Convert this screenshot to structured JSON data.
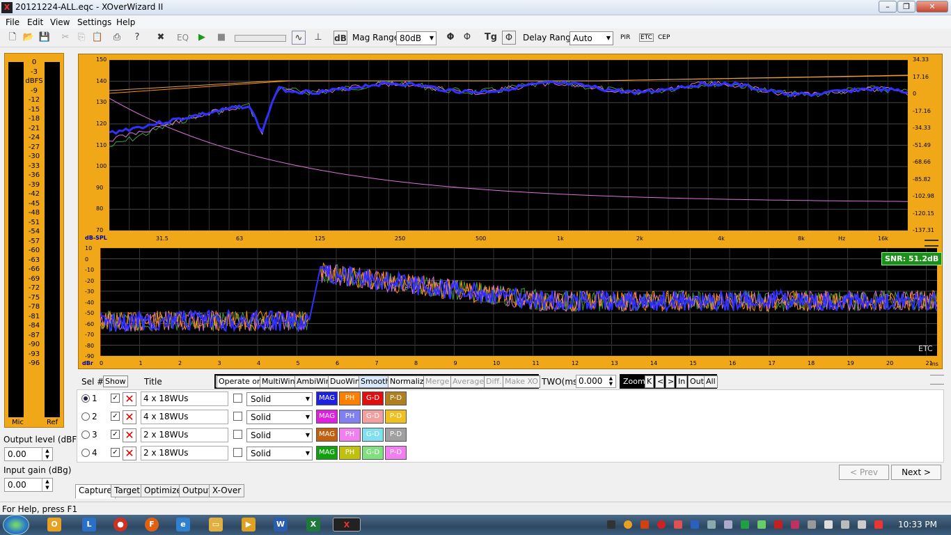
{
  "window": {
    "title": "20121224-ALL.eqc - XOverWizard II",
    "app_icon": "X"
  },
  "menu": [
    "File",
    "Edit",
    "View",
    "Settings",
    "Help"
  ],
  "toolbar": {
    "eq": "EQ",
    "db": "dB",
    "mag_range_label": "Mag Range",
    "mag_range_value": "80dB",
    "tg": "Tg",
    "delay_range_label": "Delay Range",
    "delay_range_value": "Auto",
    "pir": "PIR",
    "etc": "ETC",
    "cep": "CEP"
  },
  "meter": {
    "scale": [
      "0",
      "-3",
      "dBFS",
      "-9",
      "-12",
      "-15",
      "-18",
      "-21",
      "-24",
      "-27",
      "-30",
      "-33",
      "-36",
      "-39",
      "-42",
      "-45",
      "-48",
      "-51",
      "-54",
      "-57",
      "-60",
      "-63",
      "-66",
      "-69",
      "-72",
      "-75",
      "-78",
      "-81",
      "-84",
      "-87",
      "-90",
      "-93",
      "-96"
    ],
    "left_label": "Mic",
    "right_label": "Ref"
  },
  "output_level": {
    "label": "Output level (dBFS)",
    "value": "0.00"
  },
  "input_gain": {
    "label": "Input gain (dBg)",
    "value": "0.00"
  },
  "top_plot": {
    "unit_label": "dB-SPL",
    "left_ticks": [
      "150",
      "140",
      "130",
      "120",
      "110",
      "100",
      "90",
      "80",
      "70"
    ],
    "right_ticks": [
      "34.33",
      "17.16",
      "0",
      "-17.16",
      "-34.33",
      "-51.49",
      "-68.66",
      "-85.82",
      "-102.98",
      "-120.15",
      "-137.31"
    ],
    "x_ticks": [
      "31.5",
      "63",
      "125",
      "250",
      "500",
      "1k",
      "2k",
      "4k",
      "8k",
      "Hz",
      "16k"
    ],
    "colors": {
      "bg": "#000000",
      "frame": "#f0a818",
      "main": "#3030ff",
      "pink": "#e070e0",
      "green": "#40a040",
      "orange": "#ff9000",
      "tan": "#e0a050"
    }
  },
  "bottom_plot": {
    "unit_label": "dBr",
    "y_ticks": [
      "10",
      "0",
      "-10",
      "-20",
      "-30",
      "-40",
      "-50",
      "-60",
      "-70",
      "-80",
      "-90"
    ],
    "x_ticks": [
      "0",
      "1",
      "2",
      "3",
      "4",
      "5",
      "6",
      "7",
      "8",
      "9",
      "10",
      "11",
      "12",
      "13",
      "14",
      "15",
      "16",
      "17",
      "18",
      "19",
      "20",
      "21"
    ],
    "x_unit": "ms",
    "snr": "SNR: 51.2dB",
    "mode": "ETC"
  },
  "controls": {
    "sel_label": "Sel #",
    "show_label": "Show",
    "title_label": "Title",
    "operate_on": "Operate on",
    "ops": [
      "MultiWin",
      "AmbiWin",
      "DuoWin",
      "Smooth",
      "Normalize",
      "Merge",
      "Average",
      "Diff.",
      "Make XO"
    ],
    "two_label": "TWO(ms)",
    "two_value": "0.000",
    "zoom_label": "Zoom",
    "zoom_buttons": [
      "K",
      "<",
      ">",
      "In",
      "Out",
      "All"
    ]
  },
  "rows": [
    {
      "num": "1",
      "title": "4 x 18WUs",
      "style": "Solid",
      "tags": [
        {
          "t": "MAG",
          "c": "#2020e0"
        },
        {
          "t": "PH",
          "c": "#ff8000"
        },
        {
          "t": "G-D",
          "c": "#e01010"
        },
        {
          "t": "P-D",
          "c": "#b08020"
        }
      ]
    },
    {
      "num": "2",
      "title": "4 x 18WUs",
      "style": "Solid",
      "tags": [
        {
          "t": "MAG",
          "c": "#e020e0"
        },
        {
          "t": "PH",
          "c": "#8080f0"
        },
        {
          "t": "G-D",
          "c": "#f0a0a0"
        },
        {
          "t": "P-D",
          "c": "#f0c020"
        }
      ]
    },
    {
      "num": "3",
      "title": "2 x 18WUs",
      "style": "Solid",
      "tags": [
        {
          "t": "MAG",
          "c": "#c06010"
        },
        {
          "t": "PH",
          "c": "#f080f0"
        },
        {
          "t": "G-D",
          "c": "#80e0f0"
        },
        {
          "t": "P-D",
          "c": "#a0a0a0"
        }
      ]
    },
    {
      "num": "4",
      "title": "2 x 18WUs",
      "style": "Solid",
      "tags": [
        {
          "t": "MAG",
          "c": "#10a010"
        },
        {
          "t": "PH",
          "c": "#c0c010"
        },
        {
          "t": "G-D",
          "c": "#80e080"
        },
        {
          "t": "P-D",
          "c": "#f080f0"
        }
      ]
    }
  ],
  "nav": {
    "prev": "< Prev",
    "next": "Next >"
  },
  "tabs": [
    "Capture",
    "Target",
    "Optimizer",
    "Output",
    "X-Over"
  ],
  "status": "For Help, press F1",
  "taskbar": {
    "clock": "10:33 PM"
  }
}
